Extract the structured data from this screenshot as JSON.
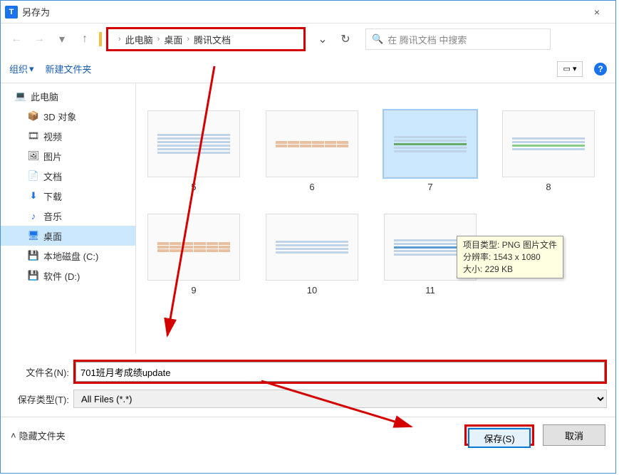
{
  "window": {
    "title": "另存为",
    "close": "×"
  },
  "nav": {
    "breadcrumb": [
      "此电脑",
      "桌面",
      "腾讯文档"
    ],
    "search_placeholder": "在 腾讯文档 中搜索"
  },
  "toolbar": {
    "organize": "组织",
    "new_folder": "新建文件夹"
  },
  "sidebar": {
    "items": [
      {
        "label": "此电脑",
        "icon": "💻"
      },
      {
        "label": "3D 对象",
        "icon": "📦"
      },
      {
        "label": "视频",
        "icon": "🎞"
      },
      {
        "label": "图片",
        "icon": "🖼"
      },
      {
        "label": "文档",
        "icon": "📄"
      },
      {
        "label": "下载",
        "icon": "⬇"
      },
      {
        "label": "音乐",
        "icon": "♪"
      },
      {
        "label": "桌面",
        "icon": "🖥",
        "selected": true
      },
      {
        "label": "本地磁盘 (C:)",
        "icon": "💾"
      },
      {
        "label": "软件 (D:)",
        "icon": "💾"
      }
    ]
  },
  "content": {
    "row1": [
      {
        "label": "5"
      },
      {
        "label": "6"
      },
      {
        "label": "7",
        "selected": true
      },
      {
        "label": "8"
      }
    ],
    "row2": [
      {
        "label": "9"
      },
      {
        "label": "10"
      },
      {
        "label": "11"
      }
    ]
  },
  "tooltip": {
    "line1": "项目类型: PNG 图片文件",
    "line2": "分辨率: 1543 x 1080",
    "line3": "大小: 229 KB"
  },
  "filename": {
    "label": "文件名(N):",
    "value": "701班月考成绩update"
  },
  "filetype": {
    "label": "保存类型(T):",
    "value": "All Files (*.*)"
  },
  "footer": {
    "hide_folders": "隐藏文件夹",
    "save": "保存(S)",
    "cancel": "取消"
  }
}
